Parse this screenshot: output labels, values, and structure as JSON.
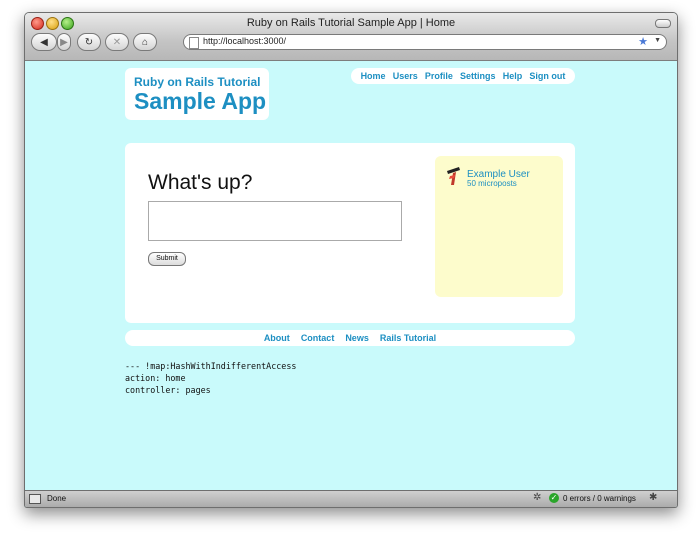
{
  "window": {
    "title": "Ruby on Rails Tutorial Sample App | Home"
  },
  "toolbar": {
    "back_icon": "back-arrow-icon",
    "forward_icon": "forward-arrow-icon",
    "reload_icon": "reload-icon",
    "stop_icon": "stop-icon",
    "home_icon": "home-icon",
    "url": "http://localhost:3000/",
    "bookmark_icon": "star-icon"
  },
  "header": {
    "logo_line1": "Ruby on Rails Tutorial",
    "logo_line2": "Sample App",
    "nav": [
      "Home",
      "Users",
      "Profile",
      "Settings",
      "Help",
      "Sign out"
    ]
  },
  "main": {
    "heading": "What's up?",
    "post_placeholder": "",
    "submit_label": "Submit"
  },
  "sidebar": {
    "user_name": "Example User",
    "microposts": "50 microposts",
    "avatar_icon": "gravatar-logo-icon"
  },
  "footer": {
    "links": [
      "About",
      "Contact",
      "News",
      "Rails Tutorial"
    ]
  },
  "debug": {
    "lines": [
      "--- !map:HashWithIndifferentAccess",
      "action: home",
      "controller: pages"
    ]
  },
  "status": {
    "left_text": "Done",
    "right_text": "0 errors / 0 warnings"
  },
  "colors": {
    "page_bg": "#c9fafb",
    "link": "#1d8fc2",
    "sidebar_bg": "#fdfccc"
  }
}
